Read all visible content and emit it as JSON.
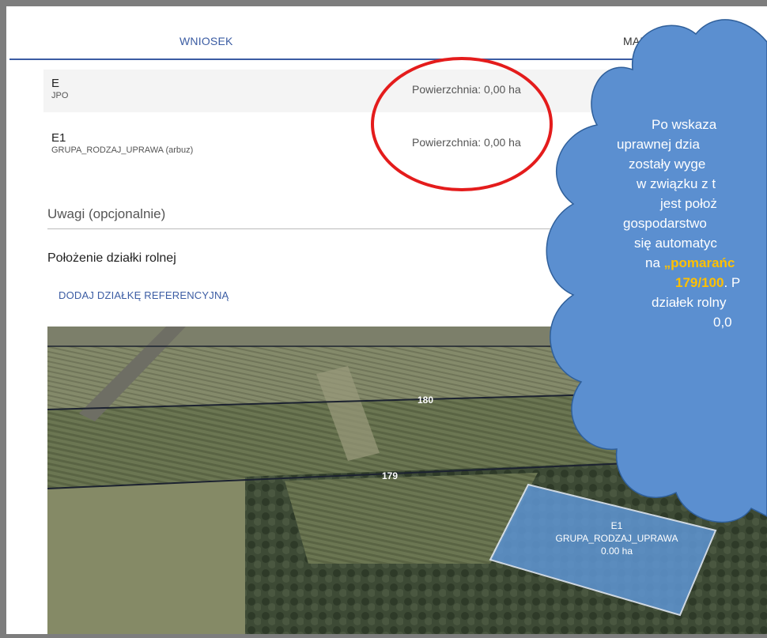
{
  "tabs": {
    "wniosek": "WNIOSEK",
    "mapa": "MAPA"
  },
  "rows": [
    {
      "code": "E",
      "sub": "JPO",
      "area": "Powierzchnia: 0,00 ha"
    },
    {
      "code": "E1",
      "sub": "GRUPA_RODZAJ_UPRAWA (arbuz)",
      "area": "Powierzchnia: 0,00 ha"
    }
  ],
  "notes_placeholder": "Uwagi (opcjonalnie)",
  "location": {
    "title": "Położenie działki rolnej",
    "add_link": "DODAJ DZIAŁKĘ REFERENCYJNĄ"
  },
  "map": {
    "parcels": [
      "180",
      "179"
    ],
    "polygon": {
      "code": "E1",
      "group": "GRUPA_RODZAJ_UPRAWA",
      "area": "0.00 ha"
    }
  },
  "callout": {
    "lines": [
      "Po wskaza",
      "uprawnej dzia",
      "zostały wyge",
      "w związku z t",
      "jest położ",
      "gospodarstwo",
      "się automatyc",
      "na ",
      "179/100",
      ". P",
      "działek rolny",
      "0,0"
    ],
    "highlight_1": "„pomarańc",
    "accent_color": "#ffc000"
  },
  "colors": {
    "accent": "#3b5ca3",
    "marker": "#e41c1c",
    "callout": "#5b8fd0"
  }
}
